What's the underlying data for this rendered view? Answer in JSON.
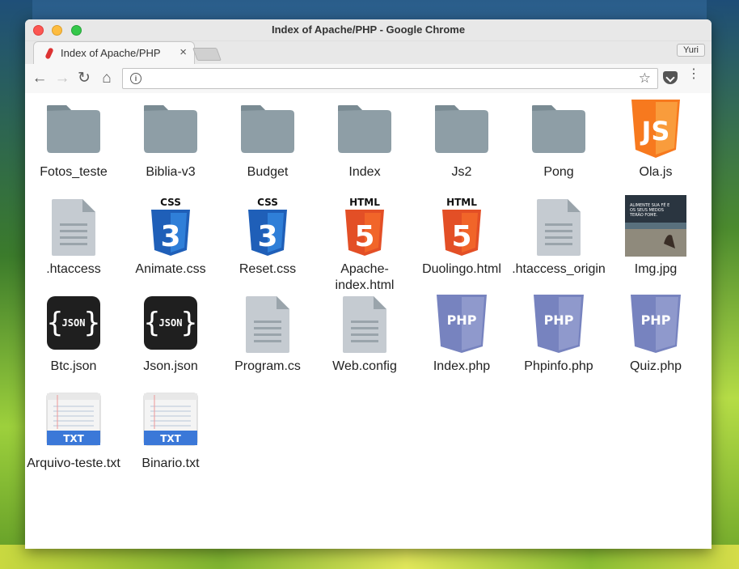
{
  "window": {
    "title": "Index of Apache/PHP - Google Chrome",
    "tab_label": "Index of Apache/PHP",
    "tab_close": "×",
    "user_label": "Yuri"
  },
  "toolbar": {
    "back_icon": "←",
    "forward_icon": "→",
    "reload_icon": "↻",
    "home_icon": "⌂",
    "url": "",
    "info_icon": "i",
    "star_icon": "☆",
    "menu_icon": "⋮"
  },
  "files": [
    {
      "name": "Fotos_teste",
      "icon": "folder-icon"
    },
    {
      "name": "Biblia-v3",
      "icon": "folder-icon"
    },
    {
      "name": "Budget",
      "icon": "folder-icon"
    },
    {
      "name": "Index",
      "icon": "folder-icon"
    },
    {
      "name": "Js2",
      "icon": "folder-icon"
    },
    {
      "name": "Pong",
      "icon": "folder-icon"
    },
    {
      "name": "Ola.js",
      "icon": "js-icon"
    },
    {
      "name": ".htaccess",
      "icon": "document-icon"
    },
    {
      "name": "Animate.css",
      "icon": "css-icon"
    },
    {
      "name": "Reset.css",
      "icon": "css-icon"
    },
    {
      "name": "Apache-index.html",
      "icon": "html-icon"
    },
    {
      "name": "Duolingo.html",
      "icon": "html-icon"
    },
    {
      "name": ".htaccess_origin",
      "icon": "document-icon"
    },
    {
      "name": "Img.jpg",
      "icon": "image-thumbnail-icon"
    },
    {
      "name": "Btc.json",
      "icon": "json-icon"
    },
    {
      "name": "Json.json",
      "icon": "json-icon"
    },
    {
      "name": "Program.cs",
      "icon": "document-icon"
    },
    {
      "name": "Web.config",
      "icon": "document-icon"
    },
    {
      "name": "Index.php",
      "icon": "php-icon"
    },
    {
      "name": "Phpinfo.php",
      "icon": "php-icon"
    },
    {
      "name": "Quiz.php",
      "icon": "php-icon"
    },
    {
      "name": "Arquivo-teste.txt",
      "icon": "txt-icon"
    },
    {
      "name": "Binario.txt",
      "icon": "txt-icon"
    }
  ],
  "icon_text": {
    "css_top": "CSS",
    "css_num": "3",
    "html_top": "HTML",
    "html_num": "5",
    "js": "JS",
    "json": "JSON",
    "php": "PHP",
    "txt": "TXT",
    "img_caption_1": "ALIMENTE SUA FÉ E",
    "img_caption_2": "OS SEUS MEDOS",
    "img_caption_3": "TERÃO FOME."
  },
  "colors": {
    "folder": "#8e9ea6",
    "folder_dark": "#7a8b93",
    "css": "#1f5fb8",
    "html": "#e34f26",
    "js": "#f7791e",
    "php": "#7783bf",
    "json_bg": "#1f1f1f",
    "txt_band": "#3b78d8"
  }
}
